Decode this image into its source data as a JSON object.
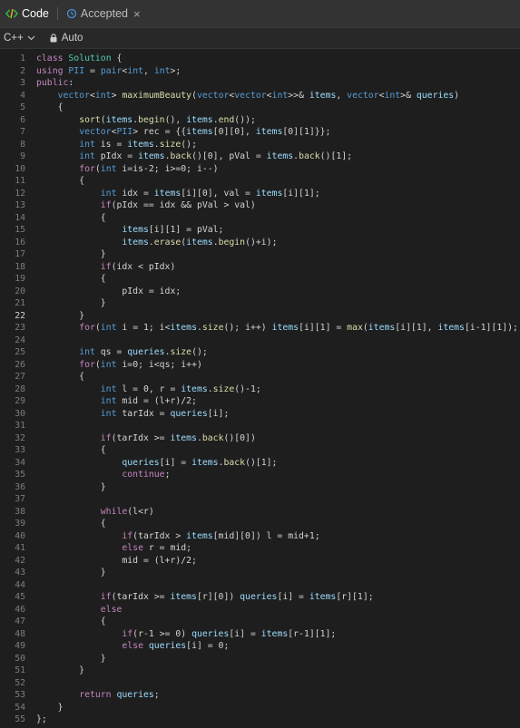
{
  "tabs": [
    {
      "label": "Code",
      "icon": "code-icon"
    },
    {
      "label": "Accepted",
      "icon": "history-icon",
      "close": "×"
    }
  ],
  "toolbar": {
    "language": "C++",
    "mode": "Auto"
  },
  "code_lines": [
    "class Solution {",
    "using PII = pair<int, int>;",
    "public:",
    "    vector<int> maximumBeauty(vector<vector<int>>& items, vector<int>& queries)",
    "    {",
    "        sort(items.begin(), items.end());",
    "        vector<PII> rec = {{items[0][0], items[0][1]}};",
    "        int is = items.size();",
    "        int pIdx = items.back()[0], pVal = items.back()[1];",
    "        for(int i=is-2; i>=0; i--)",
    "        {",
    "            int idx = items[i][0], val = items[i][1];",
    "            if(pIdx == idx && pVal > val)",
    "            {",
    "                items[i][1] = pVal;",
    "                items.erase(items.begin()+i);",
    "            }",
    "            if(idx < pIdx)",
    "            {",
    "                pIdx = idx;",
    "            }",
    "        }",
    "        for(int i = 1; i<items.size(); i++) items[i][1] = max(items[i][1], items[i-1][1]);",
    "",
    "        int qs = queries.size();",
    "        for(int i=0; i<qs; i++)",
    "        {",
    "            int l = 0, r = items.size()-1;",
    "            int mid = (l+r)/2;",
    "            int tarIdx = queries[i];",
    "",
    "            if(tarIdx >= items.back()[0])",
    "            {",
    "                queries[i] = items.back()[1];",
    "                continue;",
    "            }",
    "",
    "            while(l<r)",
    "            {",
    "                if(tarIdx > items[mid][0]) l = mid+1;",
    "                else r = mid;",
    "                mid = (l+r)/2;",
    "            }",
    "",
    "            if(tarIdx >= items[r][0]) queries[i] = items[r][1];",
    "            else",
    "            {",
    "                if(r-1 >= 0) queries[i] = items[r-1][1];",
    "                else queries[i] = 0;",
    "            }",
    "        }",
    "",
    "        return queries;",
    "    }",
    "};"
  ],
  "current_line": 22,
  "colors": {
    "background": "#1e1e1e",
    "keyword": "#c586c0",
    "type": "#569cd6",
    "function": "#dcdcaa",
    "variable": "#9cdcfe"
  }
}
